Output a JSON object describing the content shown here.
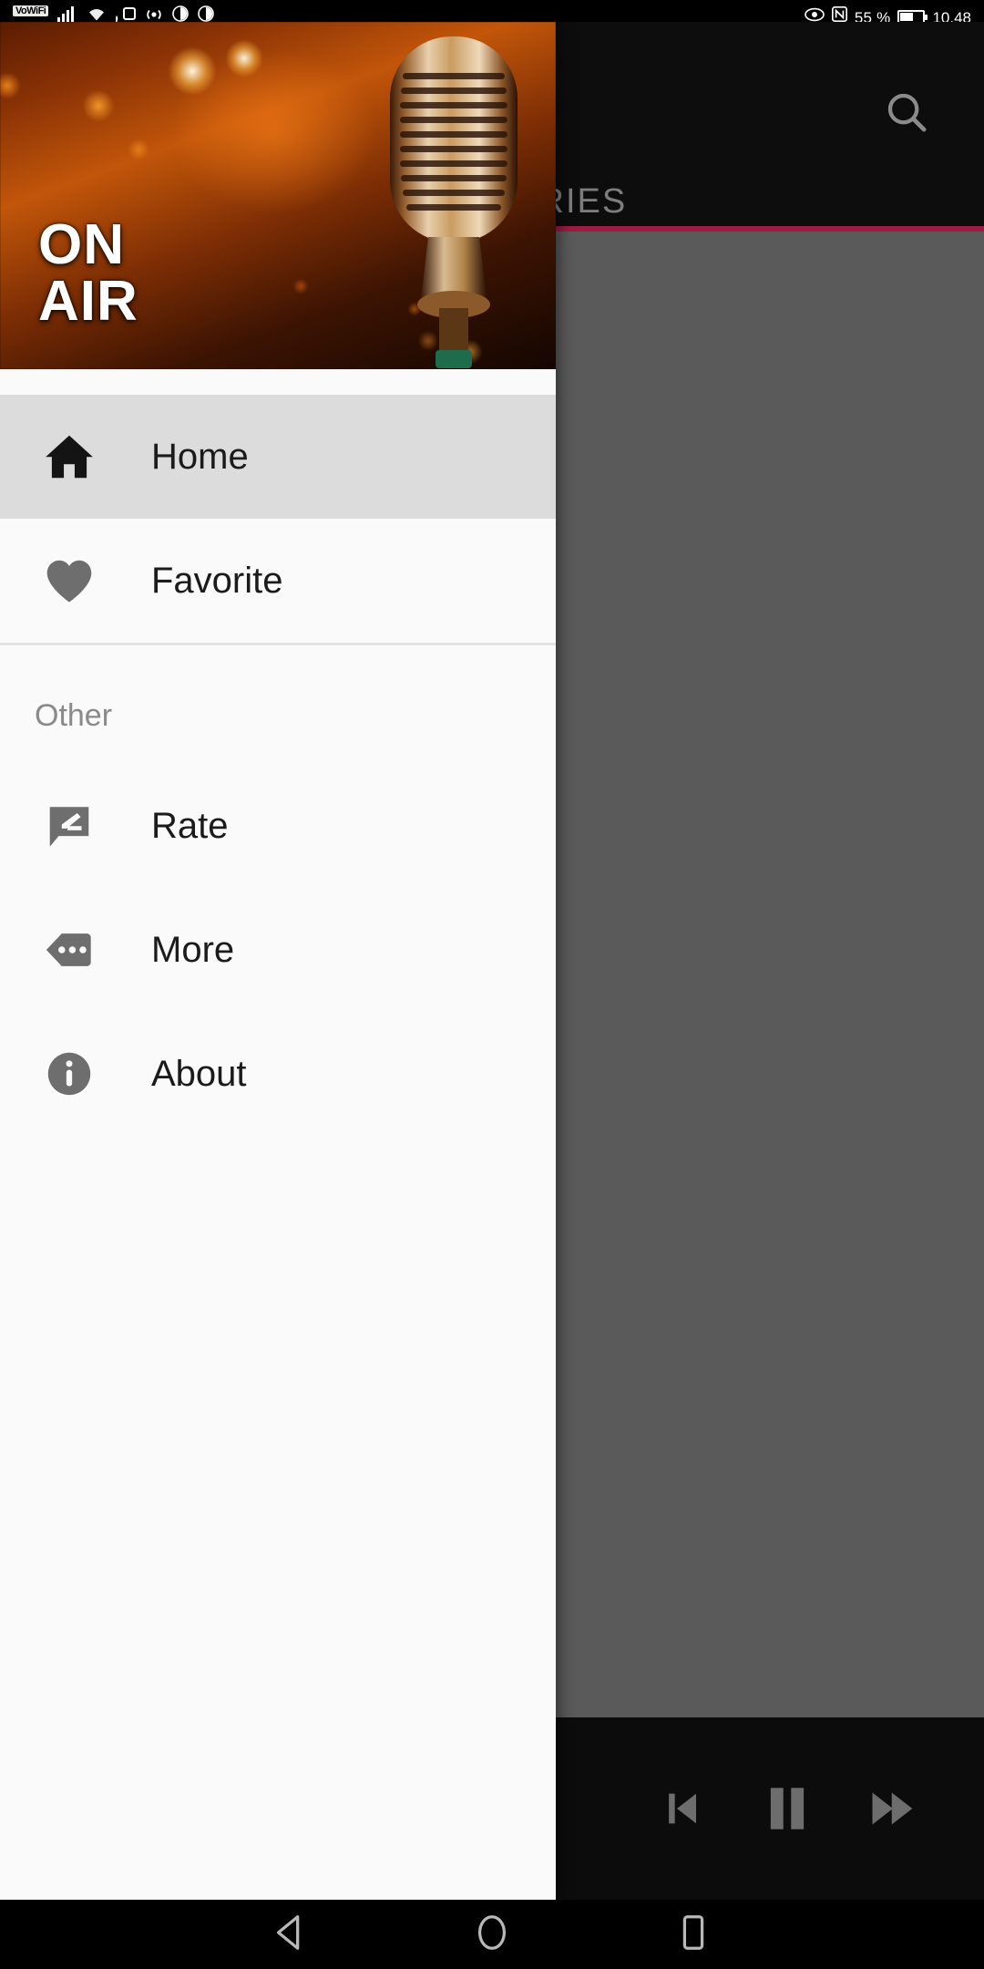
{
  "statusbar": {
    "vowifi_badge": "VoWiFi",
    "battery_percent": "55 %",
    "clock": "10.48",
    "icons_left": [
      "vowifi-badge",
      "signal-bars-icon",
      "wifi-icon",
      "cast-icon",
      "hotspot-icon",
      "location-icon",
      "location-secondary-icon"
    ],
    "icons_right": [
      "eye-icon",
      "nfc-icon",
      "battery-icon"
    ]
  },
  "drawer": {
    "header": {
      "line1": "ON",
      "line2": "AIR",
      "image_name": "radio-microphone-on-air-photo"
    },
    "items": [
      {
        "label": "Home",
        "icon": "home-icon",
        "selected": true
      },
      {
        "label": "Favorite",
        "icon": "heart-icon",
        "selected": false
      }
    ],
    "section_title": "Other",
    "other_items": [
      {
        "label": "Rate",
        "icon": "rate-comment-edit-icon"
      },
      {
        "label": "More",
        "icon": "more-tag-dots-icon"
      },
      {
        "label": "About",
        "icon": "info-circle-icon"
      }
    ]
  },
  "behind": {
    "search_icon": "search-icon",
    "tab_label": "ORIES",
    "accent_color": "#9e1b42",
    "player": {
      "previous_label": "previous-icon",
      "pause_label": "pause-icon",
      "next_label": "fast-forward-icon"
    }
  },
  "navbar": {
    "back": "back-triangle-icon",
    "home": "home-circle-icon",
    "recents": "recents-square-icon"
  }
}
